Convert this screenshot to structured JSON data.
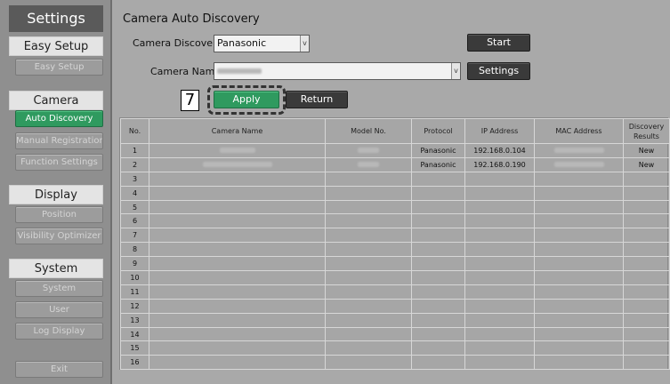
{
  "sidebar": {
    "title": "Settings",
    "sections": [
      {
        "header": "Easy Setup",
        "items": [
          "Easy Setup"
        ]
      },
      {
        "header": "Camera",
        "items": [
          "Auto Discovery",
          "Manual Registration",
          "Function Settings"
        ]
      },
      {
        "header": "Display",
        "items": [
          "Position",
          "Visibility Optimizer"
        ]
      },
      {
        "header": "System",
        "items": [
          "System",
          "User",
          "Log Display"
        ]
      }
    ],
    "exit": "Exit"
  },
  "main": {
    "title": "Camera Auto Discovery",
    "discovery_label": "Camera Discovery",
    "discovery_value": "Panasonic",
    "start_button": "Start",
    "camera_name_label": "Camera Name",
    "settings_button": "Settings",
    "apply_button": "Apply",
    "return_button": "Return",
    "step_number": "7"
  },
  "table": {
    "headers": [
      "No.",
      "Camera Name",
      "Model No.",
      "Protocol",
      "IP Address",
      "MAC Address",
      "Discovery Results"
    ],
    "rows": [
      {
        "no": "1",
        "protocol": "Panasonic",
        "ip": "192.168.0.104",
        "result": "New"
      },
      {
        "no": "2",
        "protocol": "Panasonic",
        "ip": "192.168.0.190",
        "result": "New"
      },
      {
        "no": "3"
      },
      {
        "no": "4"
      },
      {
        "no": "5"
      },
      {
        "no": "6"
      },
      {
        "no": "7"
      },
      {
        "no": "8"
      },
      {
        "no": "9"
      },
      {
        "no": "10"
      },
      {
        "no": "11"
      },
      {
        "no": "12"
      },
      {
        "no": "13"
      },
      {
        "no": "14"
      },
      {
        "no": "15"
      },
      {
        "no": "16"
      }
    ]
  },
  "colors": {
    "accent_green": "#2f9a5f",
    "dark_button": "#3a3a3a",
    "panel_gray": "#a9a9a9"
  }
}
